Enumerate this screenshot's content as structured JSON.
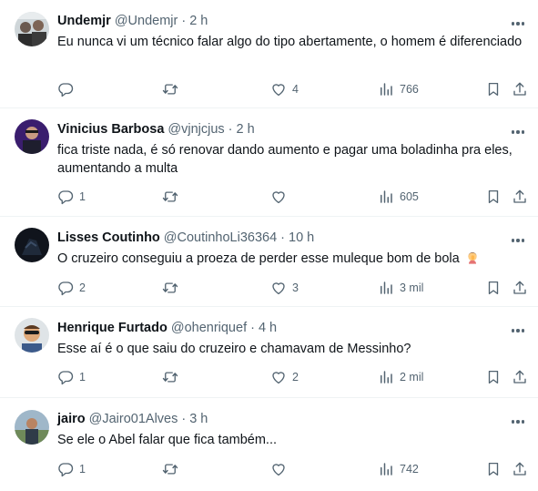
{
  "tweets": [
    {
      "name": "Undemjr",
      "handle": "@Undemjr",
      "separator": "·",
      "time": "2 h",
      "text": "Eu nunca vi um técnico falar algo do tipo abertamente, o homem é diferenciado",
      "replies": "",
      "retweets": "",
      "likes": "4",
      "views": "766"
    },
    {
      "name": "Vinicius Barbosa",
      "handle": "@vjnjcjus",
      "separator": "·",
      "time": "2 h",
      "text": "fica triste nada, é só renovar dando aumento e pagar uma boladinha pra eles, aumentando a multa",
      "replies": "1",
      "retweets": "",
      "likes": "",
      "views": "605"
    },
    {
      "name": "Lisses Coutinho",
      "handle": "@CoutinhoLi36364",
      "separator": "·",
      "time": "10 h",
      "text": "O cruzeiro conseguiu a proeza de perder esse muleque bom de bola",
      "emoji": "facepalm-emoji",
      "replies": "2",
      "retweets": "",
      "likes": "3",
      "views": "3 mil"
    },
    {
      "name": "Henrique Furtado",
      "handle": "@ohenriquef",
      "separator": "·",
      "time": "4 h",
      "text": "Esse aí é o que saiu do cruzeiro e chamavam de Messinho?",
      "replies": "1",
      "retweets": "",
      "likes": "2",
      "views": "2 mil"
    },
    {
      "name": "jairo",
      "handle": "@Jairo01Alves",
      "separator": "·",
      "time": "3 h",
      "text": "Se ele o Abel falar que fica também...",
      "replies": "1",
      "retweets": "",
      "likes": "",
      "views": "742"
    }
  ],
  "colors": {
    "text": "#0f1419",
    "secondary": "#536471",
    "divider": "#eff3f4"
  },
  "icons": [
    "more-icon",
    "reply-icon",
    "retweet-icon",
    "like-icon",
    "views-icon",
    "bookmark-icon",
    "share-icon"
  ]
}
